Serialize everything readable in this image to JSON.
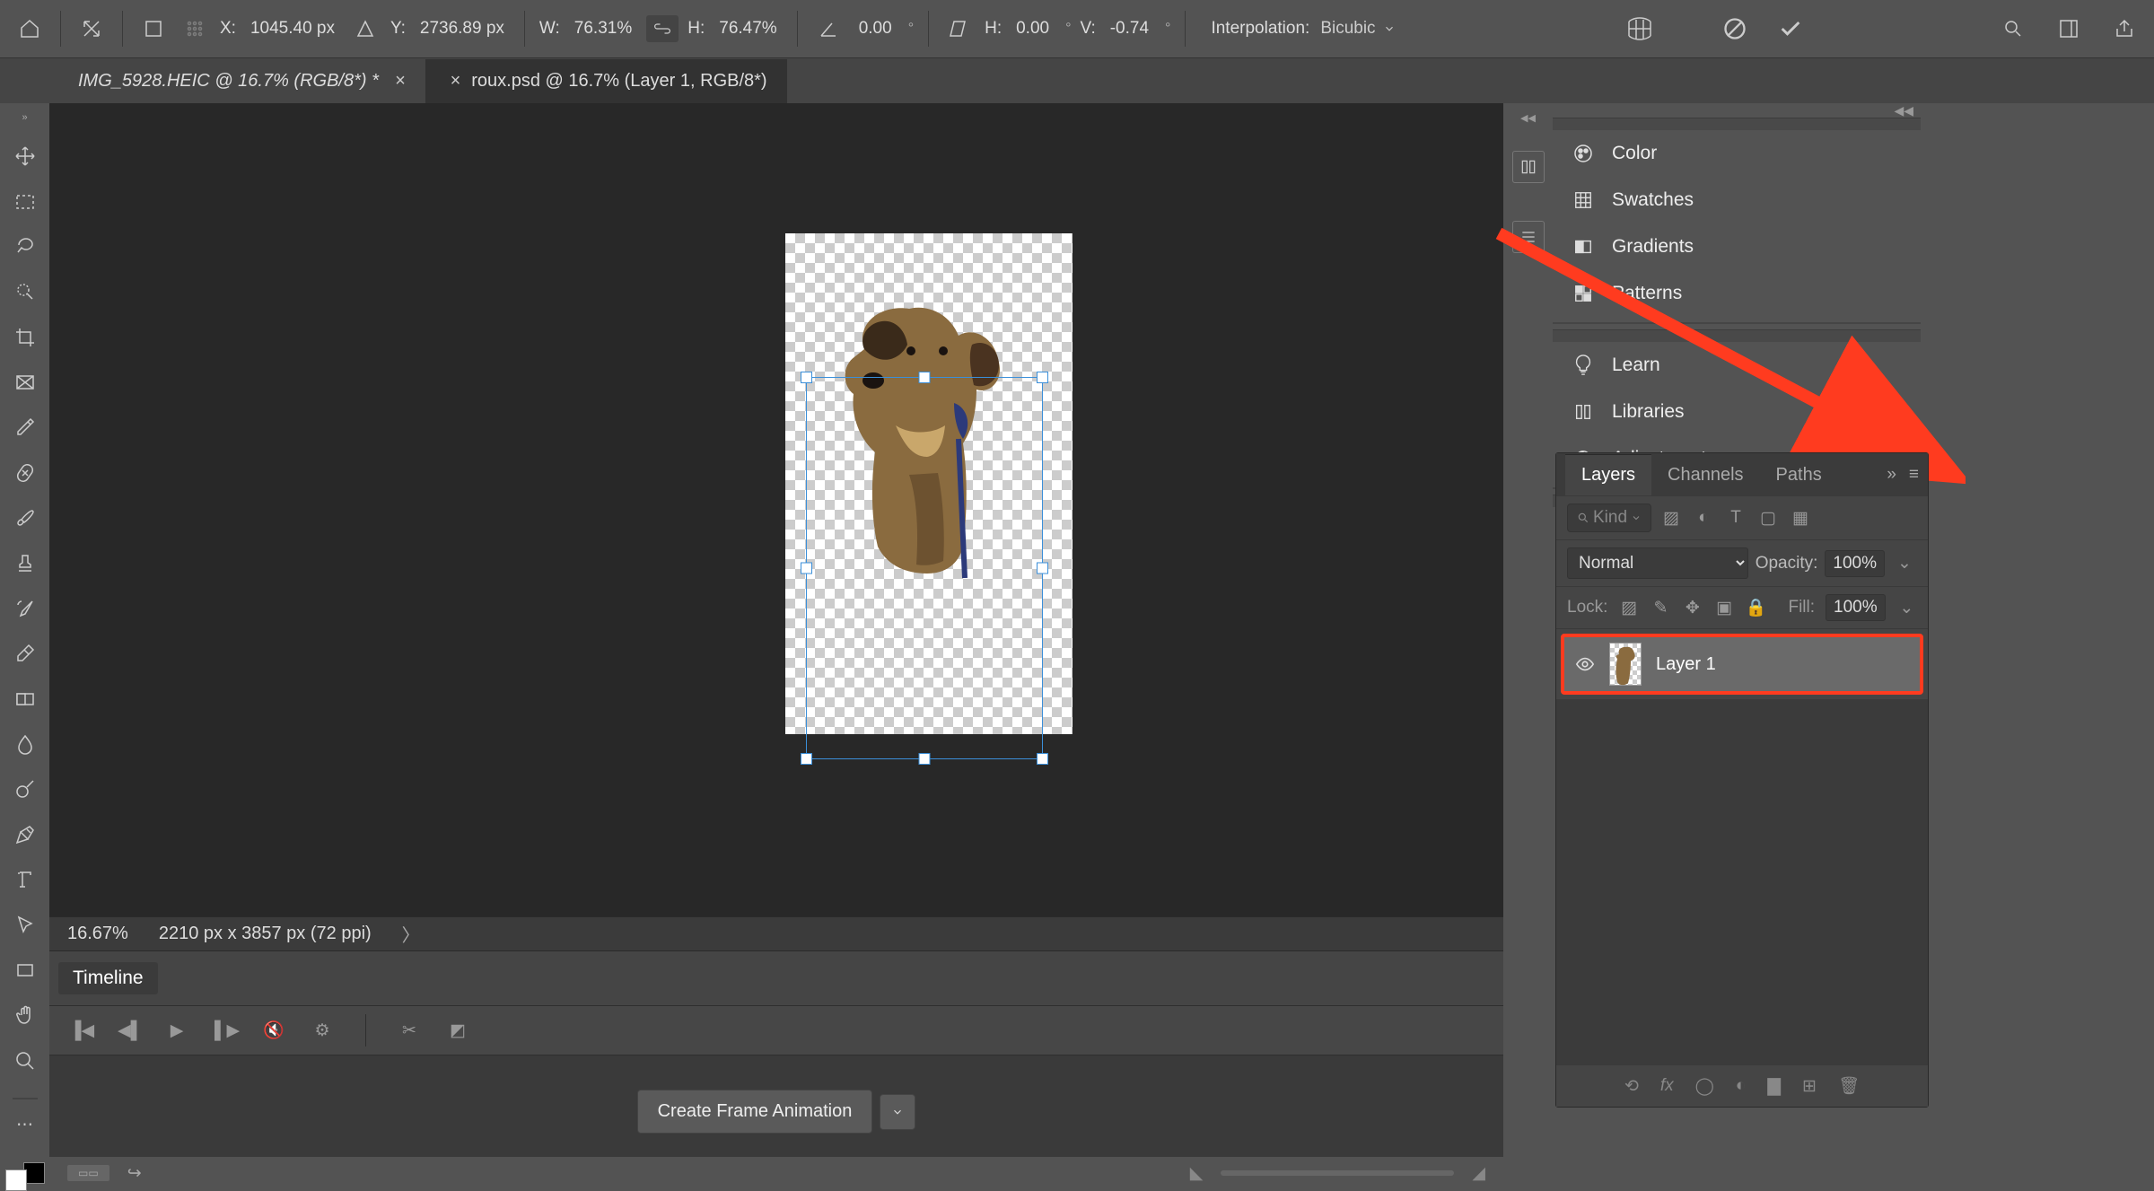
{
  "topbar": {
    "x_label": "X:",
    "x_value": "1045.40 px",
    "y_label": "Y:",
    "y_value": "2736.89 px",
    "w_label": "W:",
    "w_value": "76.31%",
    "h_label": "H:",
    "h_value": "76.47%",
    "angle_value": "0.00",
    "skew_h_label": "H:",
    "skew_h_value": "0.00",
    "skew_v_label": "V:",
    "skew_v_value": "-0.74",
    "interpolation_label": "Interpolation:",
    "interpolation_value": "Bicubic"
  },
  "tabs": [
    {
      "label": "IMG_5928.HEIC @ 16.7% (RGB/8*) *",
      "active": false
    },
    {
      "label": "roux.psd @ 16.7% (Layer 1, RGB/8*)",
      "active": true
    }
  ],
  "status": {
    "zoom": "16.67%",
    "dimensions": "2210 px x 3857 px (72 ppi)"
  },
  "timeline": {
    "title": "Timeline",
    "create_button": "Create Frame Animation"
  },
  "layers_panel": {
    "tabs": [
      "Layers",
      "Channels",
      "Paths"
    ],
    "kind_placeholder": "Kind",
    "blend_mode": "Normal",
    "opacity_label": "Opacity:",
    "opacity_value": "100%",
    "lock_label": "Lock:",
    "fill_label": "Fill:",
    "fill_value": "100%",
    "layer_name": "Layer 1"
  },
  "right_panel": {
    "items_group1": [
      "Color",
      "Swatches",
      "Gradients",
      "Patterns"
    ],
    "items_group2": [
      "Learn",
      "Libraries",
      "Adjustments"
    ],
    "items_group3": [
      "Layers",
      "Channels",
      "Paths"
    ]
  }
}
